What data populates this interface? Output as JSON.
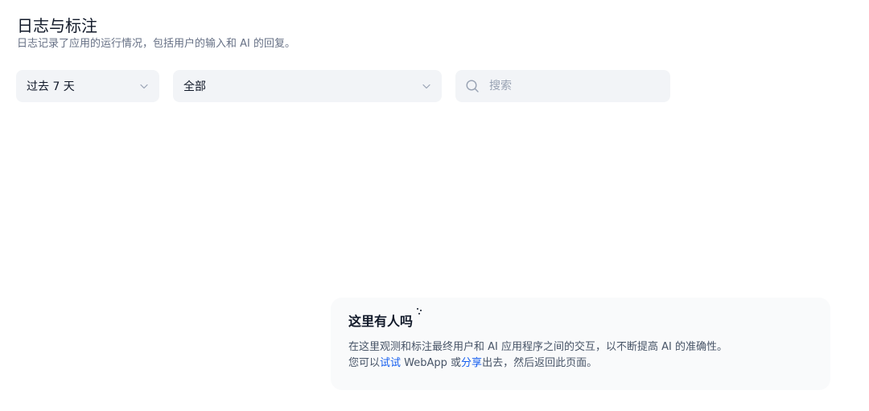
{
  "header": {
    "title": "日志与标注",
    "subtitle": "日志记录了应用的运行情况，包括用户的输入和 AI 的回复。"
  },
  "filters": {
    "period": {
      "value": "过去 7 天"
    },
    "status": {
      "value": "全部"
    },
    "search": {
      "placeholder": "搜索",
      "value": ""
    }
  },
  "empty_state": {
    "title": "这里有人吗",
    "line1": "在这里观测和标注最终用户和 AI 应用程序之间的交互，以不断提高 AI 的准确性。",
    "line2_prefix": "您可以",
    "try_link": "试试",
    "line2_mid": " WebApp 或",
    "share_link": "分享",
    "line2_suffix": "出去，然后返回此页面。"
  },
  "colors": {
    "link": "#155eef",
    "input_bg": "#f2f4f7",
    "card_bg": "#f9fafb"
  },
  "icons": {
    "chevron": "chevron-down-icon",
    "search": "search-icon",
    "decor": "sparkle-dots-icon"
  }
}
